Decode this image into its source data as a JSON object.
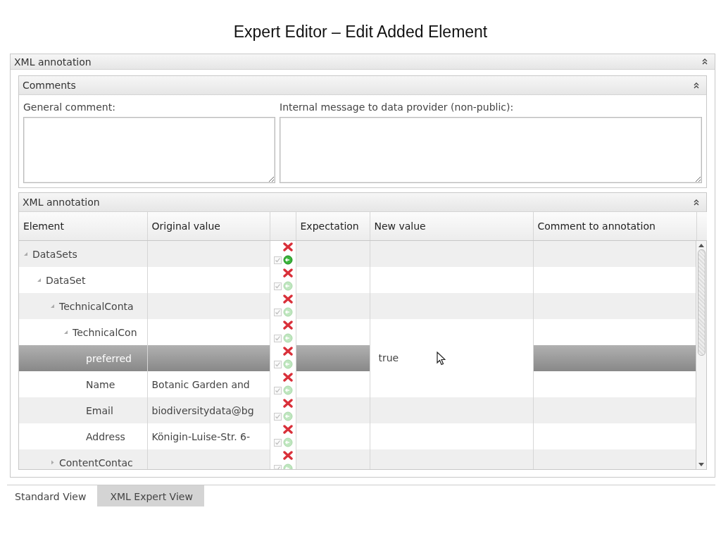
{
  "title": "Expert Editor – Edit Added Element",
  "outer_panel": {
    "title": "XML annotation"
  },
  "comments_panel": {
    "title": "Comments",
    "general_label": "General comment:",
    "internal_label": "Internal message to data provider (non-public):"
  },
  "annotation_panel": {
    "title": "XML annotation",
    "columns": [
      "Element",
      "Original value",
      "Expectation",
      "New value",
      "Comment to annotation"
    ],
    "rows": [
      {
        "element": "DataSets",
        "expanded": true,
        "selected": false,
        "accept_active": true,
        "children": [
          {
            "element": "DataSet",
            "expanded": true,
            "selected": false,
            "accept_active": false,
            "children": [
              {
                "element": "TechnicalConta",
                "expanded": true,
                "selected": false,
                "accept_active": false,
                "children": [
                  {
                    "element": "TechnicalCon",
                    "expanded": true,
                    "selected": false,
                    "accept_active": false,
                    "children": [
                      {
                        "element": "preferred",
                        "selected": true,
                        "accept_active": false,
                        "new_value": "true"
                      },
                      {
                        "element": "Name",
                        "original": "Botanic Garden and",
                        "selected": false,
                        "accept_active": false
                      },
                      {
                        "element": "Email",
                        "original": "biodiversitydata@bg",
                        "selected": false,
                        "accept_active": false
                      },
                      {
                        "element": "Address",
                        "original": "Königin-Luise-Str. 6-",
                        "selected": false,
                        "accept_active": false
                      }
                    ]
                  }
                ]
              },
              {
                "element": "ContentContac",
                "expanded": false,
                "selected": false,
                "accept_active": false
              }
            ]
          }
        ]
      }
    ]
  },
  "tabs": [
    {
      "label": "Standard View",
      "selected": true
    },
    {
      "label": "XML Expert View",
      "selected": false
    }
  ]
}
